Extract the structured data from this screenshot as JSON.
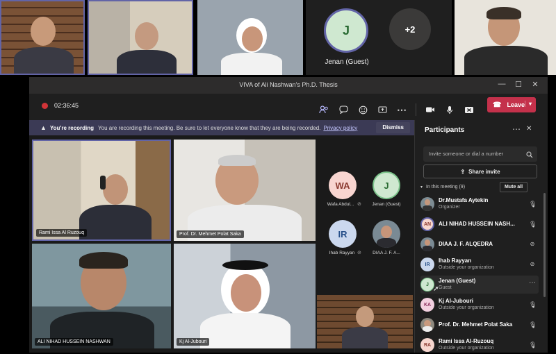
{
  "top_strip": {
    "jenan_initial": "J",
    "jenan_name": "Jenan (Guest)",
    "overflow_count": "+2"
  },
  "window": {
    "title": "VIVA of Ali Nashwan's Ph.D. Thesis",
    "minimize": "—",
    "maximize": "☐",
    "close": "✕"
  },
  "toolbar": {
    "timer": "02:36:45",
    "leave_label": "Leave"
  },
  "recording_banner": {
    "label": "You're recording",
    "message": "You are recording this meeting. Be sure to let everyone know that they are being recorded.",
    "link": "Privacy policy",
    "dismiss": "Dismiss"
  },
  "stage": {
    "tiles": [
      {
        "name": "Rami Issa Al Ruzouq"
      },
      {
        "name": "Prof. Dr. Mehmet Polat Saka"
      },
      {
        "name": "ALI NIHAD HUSSEIN NASHWAN"
      },
      {
        "name": "Kj Al-Jubouri"
      }
    ],
    "side_avatars": [
      {
        "initials": "WA",
        "label": "Wafa Abdul..."
      },
      {
        "initials": "J",
        "label": "Jenan (Guest)"
      },
      {
        "initials": "IR",
        "label": "Ihab Rayyan"
      },
      {
        "initials": "",
        "label": "DIAA J. F. A..."
      }
    ]
  },
  "participants": {
    "title": "Participants",
    "invite_placeholder": "Invite someone or dial a number",
    "share_invite": "Share invite",
    "in_meeting": "In this meeting (9)",
    "mute_all": "Mute all",
    "people": [
      {
        "initials": "",
        "name": "Dr.Mustafa Aytekin",
        "sub": "Organizer",
        "mic": "on"
      },
      {
        "initials": "AN",
        "name": "ALI NIHAD HUSSEIN NASH...",
        "sub": "",
        "mic": "on"
      },
      {
        "initials": "",
        "name": "DIAA J. F. ALQEDRA",
        "sub": "",
        "mic": "off"
      },
      {
        "initials": "IR",
        "name": "Ihab Rayyan",
        "sub": "Outside your organization",
        "mic": "off"
      },
      {
        "initials": "J",
        "name": "Jenan (Guest)",
        "sub": "Guest",
        "mic": "more"
      },
      {
        "initials": "KA",
        "name": "Kj Al-Jubouri",
        "sub": "Outside your organization",
        "mic": "on"
      },
      {
        "initials": "",
        "name": "Prof. Dr. Mehmet Polat Saka",
        "sub": "",
        "mic": "on"
      },
      {
        "initials": "RA",
        "name": "Rami Issa Al-Ruzouq",
        "sub": "Outside your organization",
        "mic": "on"
      }
    ]
  },
  "colors": {
    "accent": "#6264a7",
    "leave": "#c4314b",
    "recording_dot": "#d13438",
    "window_bg": "#1f1f1f"
  }
}
